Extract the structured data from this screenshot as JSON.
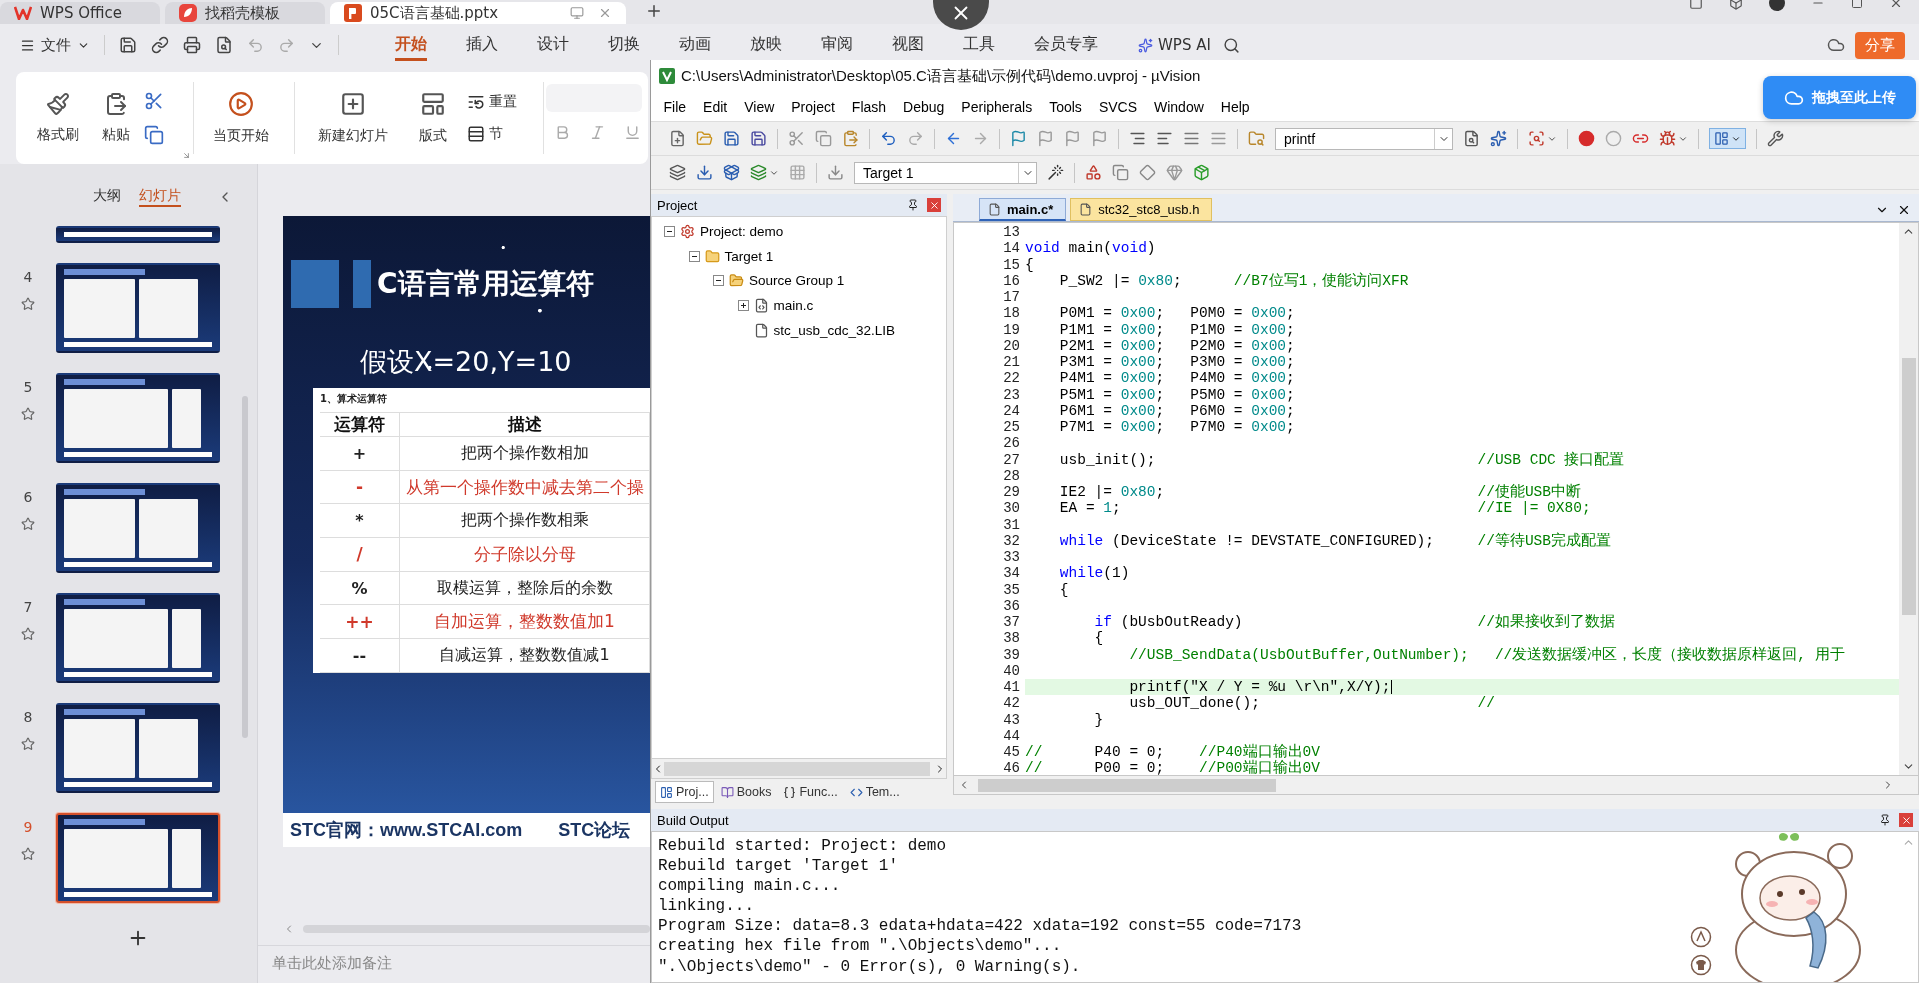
{
  "wps": {
    "tabs": [
      {
        "label": "WPS Office",
        "kind": "home",
        "selected": false
      },
      {
        "label": "找稻壳模板",
        "kind": "template",
        "selected": false
      },
      {
        "label": "05C语言基础.pptx",
        "kind": "document",
        "selected": true
      }
    ],
    "file_menu": "文件",
    "ribbon_tabs": [
      {
        "label": "开始",
        "selected": true
      },
      {
        "label": "插入",
        "selected": false
      },
      {
        "label": "设计",
        "selected": false
      },
      {
        "label": "切换",
        "selected": false
      },
      {
        "label": "动画",
        "selected": false
      },
      {
        "label": "放映",
        "selected": false
      },
      {
        "label": "审阅",
        "selected": false
      },
      {
        "label": "视图",
        "selected": false
      },
      {
        "label": "工具",
        "selected": false
      },
      {
        "label": "会员专享",
        "selected": false
      }
    ],
    "ai_button": "WPS AI",
    "share_button": "分享",
    "ribbon": {
      "format_painter": "格式刷",
      "paste": "粘贴",
      "play_from_current": "当页开始",
      "new_slide": "新建幻灯片",
      "layout": "版式",
      "reset": "重置",
      "section": "节"
    },
    "panel_tabs": [
      {
        "label": "大纲",
        "selected": false
      },
      {
        "label": "幻灯片",
        "selected": true
      }
    ],
    "thumbnails": [
      {
        "number": "4",
        "selected": false
      },
      {
        "number": "5",
        "selected": false
      },
      {
        "number": "6",
        "selected": false
      },
      {
        "number": "7",
        "selected": false
      },
      {
        "number": "8",
        "selected": false
      },
      {
        "number": "9",
        "selected": true
      }
    ],
    "notes_placeholder": "单击此处添加备注"
  },
  "slide": {
    "title": "C语言常用运算符",
    "subtitle": "假设X=20,Y=10",
    "table_caption": "1、算术运算符",
    "columns": [
      "运算符",
      "描述"
    ],
    "rows": [
      {
        "operator": "+",
        "description": "把两个操作数相加",
        "highlighted": false
      },
      {
        "operator": "-",
        "description": "从第一个操作数中减去第二个操",
        "highlighted": true
      },
      {
        "operator": "*",
        "description": "把两个操作数相乘",
        "highlighted": false
      },
      {
        "operator": "/",
        "description": "分子除以分母",
        "highlighted": true
      },
      {
        "operator": "%",
        "description": "取模运算，整除后的余数",
        "highlighted": false
      },
      {
        "operator": "++",
        "description": "自加运算，整数数值加1",
        "highlighted": true
      },
      {
        "operator": "--",
        "description": "自减运算，整数数值减1",
        "highlighted": false
      }
    ],
    "footer": [
      "STC官网：www.STCAI.com",
      "STC论坛"
    ]
  },
  "upload_button": "拖拽至此上传",
  "keil": {
    "title": "C:\\Users\\Administrator\\Desktop\\05.C语言基础\\示例代码\\demo.uvproj - µVision",
    "menu": [
      "File",
      "Edit",
      "View",
      "Project",
      "Flash",
      "Debug",
      "Peripherals",
      "Tools",
      "SVCS",
      "Window",
      "Help"
    ],
    "find_combo": "printf",
    "target_combo": "Target 1",
    "project_panel": {
      "title": "Project",
      "tree": [
        {
          "label": "Project: demo",
          "kind": "project",
          "expanded": true,
          "children": [
            {
              "label": "Target 1",
              "kind": "target",
              "expanded": true,
              "children": [
                {
                  "label": "Source Group 1",
                  "kind": "group",
                  "expanded": true,
                  "children": [
                    {
                      "label": "main.c",
                      "kind": "file",
                      "expanded": false
                    },
                    {
                      "label": "stc_usb_cdc_32.LIB",
                      "kind": "lib"
                    }
                  ]
                }
              ]
            }
          ]
        }
      ],
      "tabs": [
        {
          "label": "Proj...",
          "kind": "project",
          "selected": true
        },
        {
          "label": "Books",
          "kind": "books",
          "selected": false
        },
        {
          "label": "Func...",
          "kind": "functions",
          "selected": false
        },
        {
          "label": "Tem...",
          "kind": "templates",
          "selected": false
        }
      ]
    },
    "editor": {
      "tabs": [
        {
          "label": "main.c*",
          "selected": true
        },
        {
          "label": "stc32_stc8_usb.h",
          "selected": false
        }
      ],
      "lines": [
        {
          "number": "13",
          "current": false
        },
        {
          "number": "14",
          "current": false,
          "tokens": [
            {
              "kind": "keyword",
              "text": "void"
            },
            {
              "kind": "plain",
              "text": " main("
            },
            {
              "kind": "keyword",
              "text": "void"
            },
            {
              "kind": "plain",
              "text": ")"
            }
          ]
        },
        {
          "number": "15",
          "current": false,
          "tokens": [
            {
              "kind": "plain",
              "text": "{"
            }
          ]
        },
        {
          "number": "16",
          "current": false,
          "tokens": [
            {
              "kind": "plain",
              "text": "    P_SW2 |= "
            },
            {
              "kind": "number",
              "text": "0x80"
            },
            {
              "kind": "plain",
              "text": ";      "
            },
            {
              "kind": "comment",
              "text": "//B7位写1，使能访问XFR"
            }
          ]
        },
        {
          "number": "17",
          "current": false
        },
        {
          "number": "18",
          "current": false,
          "tokens": [
            {
              "kind": "plain",
              "text": "    P0M1 = "
            },
            {
              "kind": "number",
              "text": "0x00"
            },
            {
              "kind": "plain",
              "text": ";   P0M0 = "
            },
            {
              "kind": "number",
              "text": "0x00"
            },
            {
              "kind": "plain",
              "text": ";"
            }
          ]
        },
        {
          "number": "19",
          "current": false,
          "tokens": [
            {
              "kind": "plain",
              "text": "    P1M1 = "
            },
            {
              "kind": "number",
              "text": "0x00"
            },
            {
              "kind": "plain",
              "text": ";   P1M0 = "
            },
            {
              "kind": "number",
              "text": "0x00"
            },
            {
              "kind": "plain",
              "text": ";"
            }
          ]
        },
        {
          "number": "20",
          "current": false,
          "tokens": [
            {
              "kind": "plain",
              "text": "    P2M1 = "
            },
            {
              "kind": "number",
              "text": "0x00"
            },
            {
              "kind": "plain",
              "text": ";   P2M0 = "
            },
            {
              "kind": "number",
              "text": "0x00"
            },
            {
              "kind": "plain",
              "text": ";"
            }
          ]
        },
        {
          "number": "21",
          "current": false,
          "tokens": [
            {
              "kind": "plain",
              "text": "    P3M1 = "
            },
            {
              "kind": "number",
              "text": "0x00"
            },
            {
              "kind": "plain",
              "text": ";   P3M0 = "
            },
            {
              "kind": "number",
              "text": "0x00"
            },
            {
              "kind": "plain",
              "text": ";"
            }
          ]
        },
        {
          "number": "22",
          "current": false,
          "tokens": [
            {
              "kind": "plain",
              "text": "    P4M1 = "
            },
            {
              "kind": "number",
              "text": "0x00"
            },
            {
              "kind": "plain",
              "text": ";   P4M0 = "
            },
            {
              "kind": "number",
              "text": "0x00"
            },
            {
              "kind": "plain",
              "text": ";"
            }
          ]
        },
        {
          "number": "23",
          "current": false,
          "tokens": [
            {
              "kind": "plain",
              "text": "    P5M1 = "
            },
            {
              "kind": "number",
              "text": "0x00"
            },
            {
              "kind": "plain",
              "text": ";   P5M0 = "
            },
            {
              "kind": "number",
              "text": "0x00"
            },
            {
              "kind": "plain",
              "text": ";"
            }
          ]
        },
        {
          "number": "24",
          "current": false,
          "tokens": [
            {
              "kind": "plain",
              "text": "    P6M1 = "
            },
            {
              "kind": "number",
              "text": "0x00"
            },
            {
              "kind": "plain",
              "text": ";   P6M0 = "
            },
            {
              "kind": "number",
              "text": "0x00"
            },
            {
              "kind": "plain",
              "text": ";"
            }
          ]
        },
        {
          "number": "25",
          "current": false,
          "tokens": [
            {
              "kind": "plain",
              "text": "    P7M1 = "
            },
            {
              "kind": "number",
              "text": "0x00"
            },
            {
              "kind": "plain",
              "text": ";   P7M0 = "
            },
            {
              "kind": "number",
              "text": "0x00"
            },
            {
              "kind": "plain",
              "text": ";"
            }
          ]
        },
        {
          "number": "26",
          "current": false
        },
        {
          "number": "27",
          "current": false,
          "tokens": [
            {
              "kind": "plain",
              "text": "    usb_init();                                     "
            },
            {
              "kind": "comment",
              "text": "//USB CDC 接口配置"
            }
          ]
        },
        {
          "number": "28",
          "current": false
        },
        {
          "number": "29",
          "current": false,
          "tokens": [
            {
              "kind": "plain",
              "text": "    IE2 |= "
            },
            {
              "kind": "number",
              "text": "0x80"
            },
            {
              "kind": "plain",
              "text": ";                                    "
            },
            {
              "kind": "comment",
              "text": "//使能USB中断"
            }
          ]
        },
        {
          "number": "30",
          "current": false,
          "tokens": [
            {
              "kind": "plain",
              "text": "    EA = "
            },
            {
              "kind": "number",
              "text": "1"
            },
            {
              "kind": "plain",
              "text": ";                                         "
            },
            {
              "kind": "comment",
              "text": "//IE |= 0X80;"
            }
          ]
        },
        {
          "number": "31",
          "current": false
        },
        {
          "number": "32",
          "current": false,
          "tokens": [
            {
              "kind": "keyword",
              "text": "    while"
            },
            {
              "kind": "plain",
              "text": " (DeviceState != DEVSTATE_CONFIGURED);     "
            },
            {
              "kind": "comment",
              "text": "//等待USB完成配置"
            }
          ]
        },
        {
          "number": "33",
          "current": false
        },
        {
          "number": "34",
          "current": false,
          "tokens": [
            {
              "kind": "keyword",
              "text": "    while"
            },
            {
              "kind": "plain",
              "text": "(1)"
            }
          ]
        },
        {
          "number": "35",
          "current": false,
          "tokens": [
            {
              "kind": "plain",
              "text": "    {"
            }
          ]
        },
        {
          "number": "36",
          "current": false
        },
        {
          "number": "37",
          "current": false,
          "tokens": [
            {
              "kind": "keyword",
              "text": "        if"
            },
            {
              "kind": "plain",
              "text": " (bUsbOutReady)                           "
            },
            {
              "kind": "comment",
              "text": "//如果接收到了数据"
            }
          ]
        },
        {
          "number": "38",
          "current": false,
          "tokens": [
            {
              "kind": "plain",
              "text": "        {"
            }
          ]
        },
        {
          "number": "39",
          "current": false,
          "tokens": [
            {
              "kind": "comment",
              "text": "            //USB_SendData(UsbOutBuffer,OutNumber);   //发送数据缓冲区，长度（接收数据原样返回, 用于"
            }
          ]
        },
        {
          "number": "40",
          "current": false
        },
        {
          "number": "41",
          "current": true,
          "tokens": [
            {
              "kind": "plain",
              "text": "            printf(\"X / Y = %u \\r\\n\",X/Y);"
            }
          ]
        },
        {
          "number": "42",
          "current": false,
          "tokens": [
            {
              "kind": "plain",
              "text": "            usb_OUT_done();                         "
            },
            {
              "kind": "comment",
              "text": "//"
            }
          ]
        },
        {
          "number": "43",
          "current": false,
          "tokens": [
            {
              "kind": "plain",
              "text": "        }"
            }
          ]
        },
        {
          "number": "44",
          "current": false
        },
        {
          "number": "45",
          "current": false,
          "tokens": [
            {
              "kind": "comment",
              "text": "//"
            },
            {
              "kind": "plain",
              "text": "      P40 = 0;    "
            },
            {
              "kind": "comment",
              "text": "//P40端口输出0V"
            }
          ]
        },
        {
          "number": "46",
          "current": false,
          "tokens": [
            {
              "kind": "comment",
              "text": "//"
            },
            {
              "kind": "plain",
              "text": "      P00 = 0;    "
            },
            {
              "kind": "comment",
              "text": "//P00端口输出0V"
            }
          ]
        }
      ]
    },
    "build_output": {
      "title": "Build Output",
      "lines": [
        "Rebuild started: Project: demo",
        "Rebuild target 'Target 1'",
        "compiling main.c...",
        "linking...",
        "Program Size: data=8.3 edata+hdata=422 xdata=192 const=55 code=7173",
        "creating hex file from \".\\Objects\\demo\"...",
        "\".\\Objects\\demo\" - 0 Error(s), 0 Warning(s)."
      ]
    }
  }
}
